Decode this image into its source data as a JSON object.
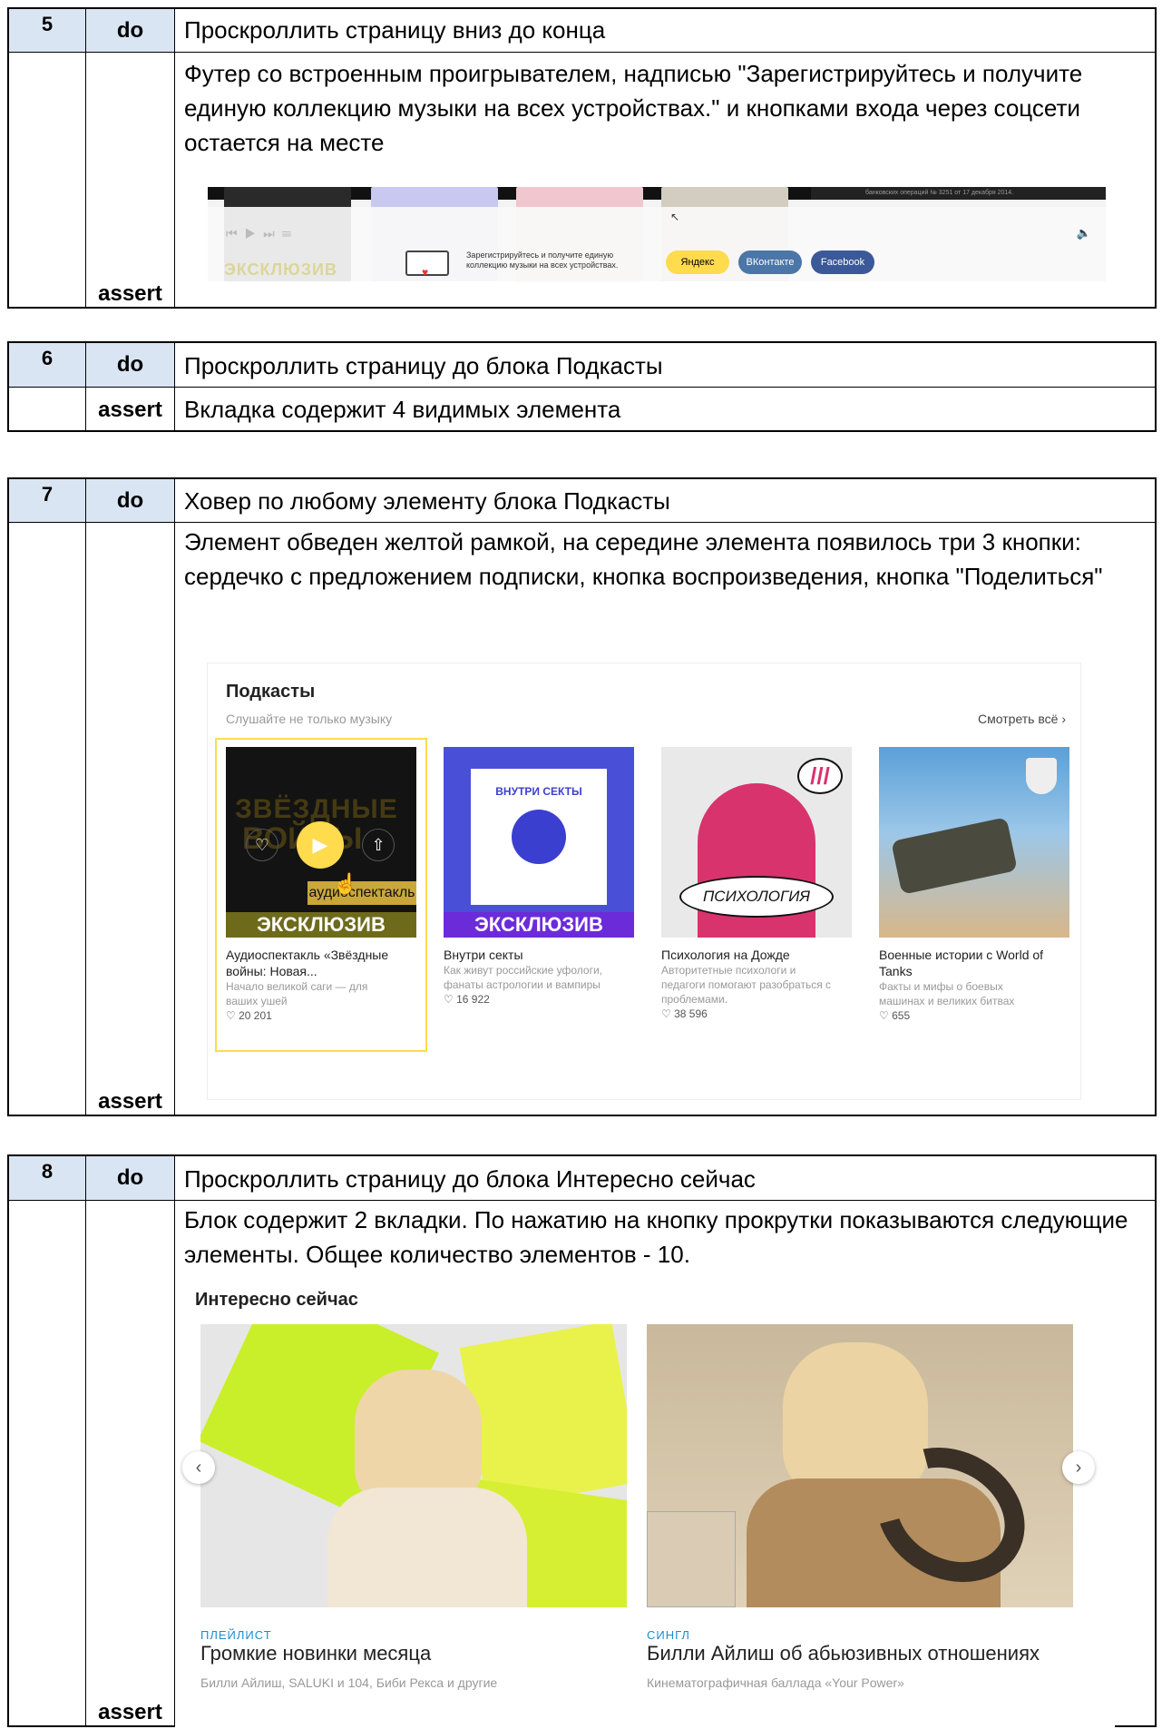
{
  "steps": [
    {
      "num": "5",
      "do_label": "do",
      "assert_label": "assert",
      "do_text": "Проскроллить страницу вниз до конца",
      "assert_text": "Футер со встроенным проигрывателем, надписью \"Зарегистрируйтесь и получите единую коллекцию музыки на всех устройствах.\" и кнопками входа через соцсети остается на месте"
    },
    {
      "num": "6",
      "do_label": "do",
      "assert_label": "assert",
      "do_text": "Проскроллить страницу до блока Подкасты",
      "assert_text": "Вкладка содержит 4 видимых элемента"
    },
    {
      "num": "7",
      "do_label": "do",
      "assert_label": "assert",
      "do_text": "Ховер по любому элементу блока Подкасты",
      "assert_text": "Элемент обведен желтой рамкой, на середине элемента появилось три 3 кнопки: сердечко с предложением подписки, кнопка воспроизведения, кнопка \"Поделиться\""
    },
    {
      "num": "8",
      "do_label": "do",
      "assert_label": "assert",
      "do_text": "Проскроллить страницу до блока Интересно сейчас",
      "assert_text": "Блок содержит 2 вкладки. По нажатию на кнопку прокрутки показываются следующие элементы. Общее количество элементов  - 10."
    }
  ],
  "footer_shot": {
    "promo": "Зарегистрируйтесь и получите единую коллекцию музыки на всех устройствах.",
    "btn_yandex": "Яндекс",
    "btn_vk": "ВКонтакте",
    "btn_fb": "Facebook",
    "badge": "ЭКСКЛЮЗИВ",
    "banner_text": "банковских операций № 3251 от 17 декабря 2014."
  },
  "podcasts": {
    "title": "Подкасты",
    "subtitle": "Слушайте не только музыку",
    "see_all": "Смотреть всё",
    "cover1_a": "ЗВЁЗДНЫЕ",
    "cover1_b": "ВОЙНЫ",
    "cover1_tag": "аудиоспектакль",
    "exclusive": "ЭКСКЛЮЗИВ",
    "cover2_art": "ВНУТРИ СЕКТЫ",
    "cover3_art": "ПСИХОЛОГИЯ",
    "items": [
      {
        "title": "Аудиоспектакль «Звёздные войны: Новая...",
        "desc": "Начало великой саги — для ваших ушей",
        "likes": "20 201"
      },
      {
        "title": "Внутри секты",
        "desc": "Как живут российские уфологи, фанаты астрологии и вампиры",
        "likes": "16 922"
      },
      {
        "title": "Психология на Дожде",
        "desc": "Авторитетные психологи и педагоги помогают разобраться с проблемами.",
        "likes": "38 596"
      },
      {
        "title": "Военные истории с World of Tanks",
        "desc": "Факты и мифы о боевых машинах и великих битвах",
        "likes": "655"
      }
    ]
  },
  "interesting": {
    "title": "Интересно сейчас",
    "cards": [
      {
        "type": "ПЛЕЙЛИСТ",
        "title": "Громкие новинки месяца",
        "desc": "Билли Айлиш, SALUKI и 104, Биби Рекса и другие"
      },
      {
        "type": "СИНГЛ",
        "title": "Билли Айлиш об абьюзивных отношениях",
        "desc": "Кинематографичная баллада «Your Power»"
      }
    ]
  },
  "colors": {
    "header_blue": "#dae5f3",
    "accent_yellow": "#ffdb4d",
    "vk_blue": "#4a76a8",
    "fb_blue": "#3b5998",
    "link_blue": "#1a8dd1"
  }
}
